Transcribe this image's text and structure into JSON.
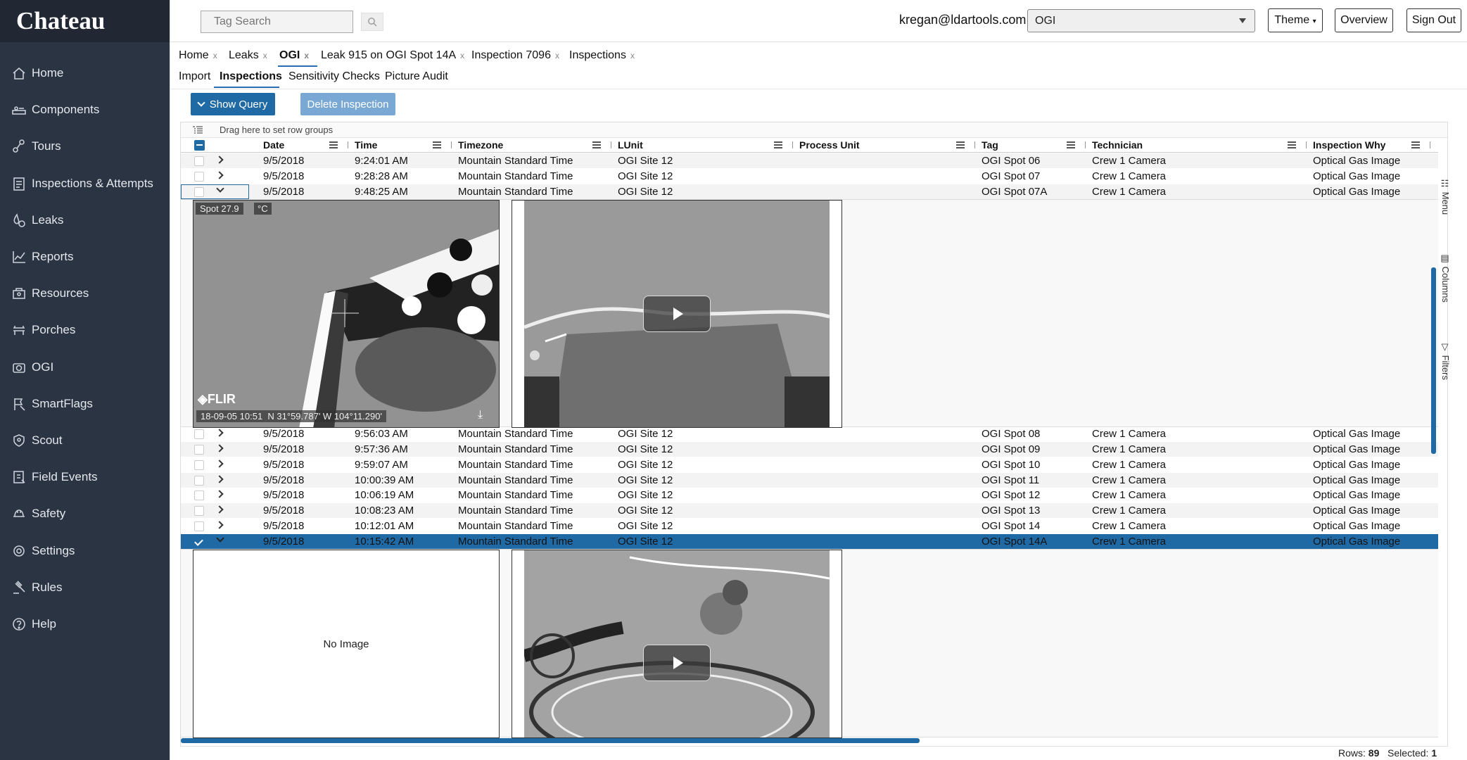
{
  "app": {
    "brand": "Chateau"
  },
  "sidebar": {
    "items": [
      {
        "label": "Home",
        "icon": "home-icon"
      },
      {
        "label": "Components",
        "icon": "components-icon"
      },
      {
        "label": "Tours",
        "icon": "tours-icon"
      },
      {
        "label": "Inspections & Attempts",
        "icon": "clipboard-icon"
      },
      {
        "label": "Leaks",
        "icon": "droplet-icon"
      },
      {
        "label": "Reports",
        "icon": "chart-icon"
      },
      {
        "label": "Resources",
        "icon": "resources-icon"
      },
      {
        "label": "Porches",
        "icon": "bench-icon"
      },
      {
        "label": "OGI",
        "icon": "camera-icon"
      },
      {
        "label": "SmartFlags",
        "icon": "flag-icon"
      },
      {
        "label": "Scout",
        "icon": "shield-icon"
      },
      {
        "label": "Field Events",
        "icon": "field-events-icon"
      },
      {
        "label": "Safety",
        "icon": "hardhat-icon"
      },
      {
        "label": "Settings",
        "icon": "gear-icon"
      },
      {
        "label": "Rules",
        "icon": "gavel-icon"
      },
      {
        "label": "Help",
        "icon": "help-icon"
      }
    ]
  },
  "topbar": {
    "search_placeholder": "Tag Search",
    "user_email": "kregan@ldartools.com",
    "context_select": "OGI",
    "theme_label": "Theme",
    "overview_label": "Overview",
    "signout_label": "Sign Out"
  },
  "tabs": [
    {
      "label": "Home",
      "close": "x"
    },
    {
      "label": "Leaks",
      "close": "x"
    },
    {
      "label": "OGI",
      "close": "x"
    },
    {
      "label": "Leak 915 on OGI Spot 14A",
      "close": "x"
    },
    {
      "label": "Inspection 7096",
      "close": "x"
    },
    {
      "label": "Inspections",
      "close": "x"
    }
  ],
  "subtabs": [
    "Import",
    "Inspections",
    "Sensitivity Checks",
    "Picture Audit"
  ],
  "actions": {
    "show_query": "Show Query",
    "delete_inspection": "Delete Inspection"
  },
  "grid": {
    "group_hint": "Drag here to set row groups",
    "columns": [
      "Date",
      "Time",
      "Timezone",
      "LUnit",
      "Process Unit",
      "Tag",
      "Technician",
      "Inspection Why"
    ],
    "rows": [
      {
        "date": "9/5/2018",
        "time": "9:24:01 AM",
        "tz": "Mountain Standard Time",
        "lunit": "OGI Site 12",
        "pu": "",
        "tag": "OGI Spot 06",
        "tech": "Crew 1 Camera",
        "why": "Optical Gas Image"
      },
      {
        "date": "9/5/2018",
        "time": "9:28:28 AM",
        "tz": "Mountain Standard Time",
        "lunit": "OGI Site 12",
        "pu": "",
        "tag": "OGI Spot 07",
        "tech": "Crew 1 Camera",
        "why": "Optical Gas Image"
      },
      {
        "date": "9/5/2018",
        "time": "9:48:25 AM",
        "tz": "Mountain Standard Time",
        "lunit": "OGI Site 12",
        "pu": "",
        "tag": "OGI Spot 07A",
        "tech": "Crew 1 Camera",
        "why": "Optical Gas Image"
      },
      {
        "date": "9/5/2018",
        "time": "9:56:03 AM",
        "tz": "Mountain Standard Time",
        "lunit": "OGI Site 12",
        "pu": "",
        "tag": "OGI Spot 08",
        "tech": "Crew 1 Camera",
        "why": "Optical Gas Image"
      },
      {
        "date": "9/5/2018",
        "time": "9:57:36 AM",
        "tz": "Mountain Standard Time",
        "lunit": "OGI Site 12",
        "pu": "",
        "tag": "OGI Spot 09",
        "tech": "Crew 1 Camera",
        "why": "Optical Gas Image"
      },
      {
        "date": "9/5/2018",
        "time": "9:59:07 AM",
        "tz": "Mountain Standard Time",
        "lunit": "OGI Site 12",
        "pu": "",
        "tag": "OGI Spot 10",
        "tech": "Crew 1 Camera",
        "why": "Optical Gas Image"
      },
      {
        "date": "9/5/2018",
        "time": "10:00:39 AM",
        "tz": "Mountain Standard Time",
        "lunit": "OGI Site 12",
        "pu": "",
        "tag": "OGI Spot 11",
        "tech": "Crew 1 Camera",
        "why": "Optical Gas Image"
      },
      {
        "date": "9/5/2018",
        "time": "10:06:19 AM",
        "tz": "Mountain Standard Time",
        "lunit": "OGI Site 12",
        "pu": "",
        "tag": "OGI Spot 12",
        "tech": "Crew 1 Camera",
        "why": "Optical Gas Image"
      },
      {
        "date": "9/5/2018",
        "time": "10:08:23 AM",
        "tz": "Mountain Standard Time",
        "lunit": "OGI Site 12",
        "pu": "",
        "tag": "OGI Spot 13",
        "tech": "Crew 1 Camera",
        "why": "Optical Gas Image"
      },
      {
        "date": "9/5/2018",
        "time": "10:12:01 AM",
        "tz": "Mountain Standard Time",
        "lunit": "OGI Site 12",
        "pu": "",
        "tag": "OGI Spot 14",
        "tech": "Crew 1 Camera",
        "why": "Optical Gas Image"
      },
      {
        "date": "9/5/2018",
        "time": "10:15:42 AM",
        "tz": "Mountain Standard Time",
        "lunit": "OGI Site 12",
        "pu": "",
        "tag": "OGI Spot 14A",
        "tech": "Crew 1 Camera",
        "why": "Optical Gas Image"
      }
    ],
    "detail1": {
      "spot_label": "Spot 27.9",
      "unit_label": "°C",
      "brand_label": "FLIR",
      "caption": "18-09-05 10:51  N 31°59.787' W 104°11.290'"
    },
    "detail2": {
      "no_image": "No Image"
    }
  },
  "sidetools": {
    "menu": "Menu",
    "columns": "Columns",
    "filters": "Filters"
  },
  "status": {
    "rows_label": "Rows:",
    "rows_value": "89",
    "selected_label": "Selected:",
    "selected_value": "1"
  },
  "colors": {
    "sidebar": "#2b3442",
    "accent": "#1f6aa5",
    "disabled_button": "#7aa8d4"
  }
}
